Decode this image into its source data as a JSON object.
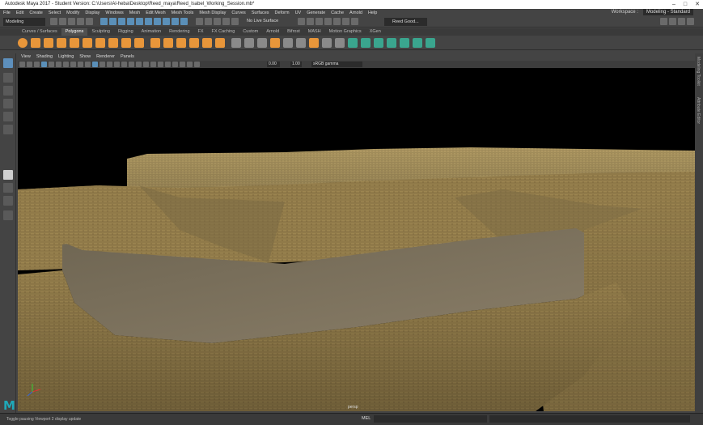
{
  "window": {
    "title": "Autodesk Maya 2017 - Student Version: C:\\Users\\Al-heba\\Desktop\\Reed_maya\\Reed_Isabel_Working_Session.mb*",
    "controls": [
      "–",
      "□",
      "✕"
    ]
  },
  "menubar": {
    "items": [
      "File",
      "Edit",
      "Create",
      "Select",
      "Modify",
      "Display",
      "Windows",
      "Mesh",
      "Edit Mesh",
      "Mesh Tools",
      "Mesh Display",
      "Curves",
      "Surfaces",
      "Deform",
      "UV",
      "Generate",
      "Cache",
      "Arnold",
      "Help"
    ],
    "workspace_label": "Workspace :",
    "workspace_value": "Modeling - Standard"
  },
  "statusline": {
    "mode": "Modeling",
    "live_surface": "No Live Surface",
    "camera_set": "Reed Good..."
  },
  "shelf": {
    "tabs": [
      "Curves / Surfaces",
      "Polygons",
      "Sculpting",
      "Rigging",
      "Animation",
      "Rendering",
      "FX",
      "FX Caching",
      "Custom",
      "Arnold",
      "Bifrost",
      "MASH",
      "Motion Graphics",
      "XGen"
    ],
    "active_tab": "Polygons"
  },
  "viewport": {
    "menus": [
      "View",
      "Shading",
      "Lighting",
      "Show",
      "Renderer",
      "Panels"
    ],
    "field_a": "0.00",
    "field_b": "1.00",
    "color_space": "sRGB gamma",
    "camera_label": "persp"
  },
  "right_panel": {
    "tabs": [
      "Modeling Toolkit",
      "Attribute Editor"
    ]
  },
  "bottom": {
    "help_line": "Toggle pausing Viewport 2 display update",
    "mel_label": "MEL"
  },
  "logo": "M",
  "colors": {
    "ui_bg": "#444444",
    "accent_blue": "#5d8fbc",
    "shelf_orange": "#e8963a",
    "shelf_teal": "#3aa58e",
    "terrain": "#9c8550",
    "floor": "#7a6f5c"
  }
}
